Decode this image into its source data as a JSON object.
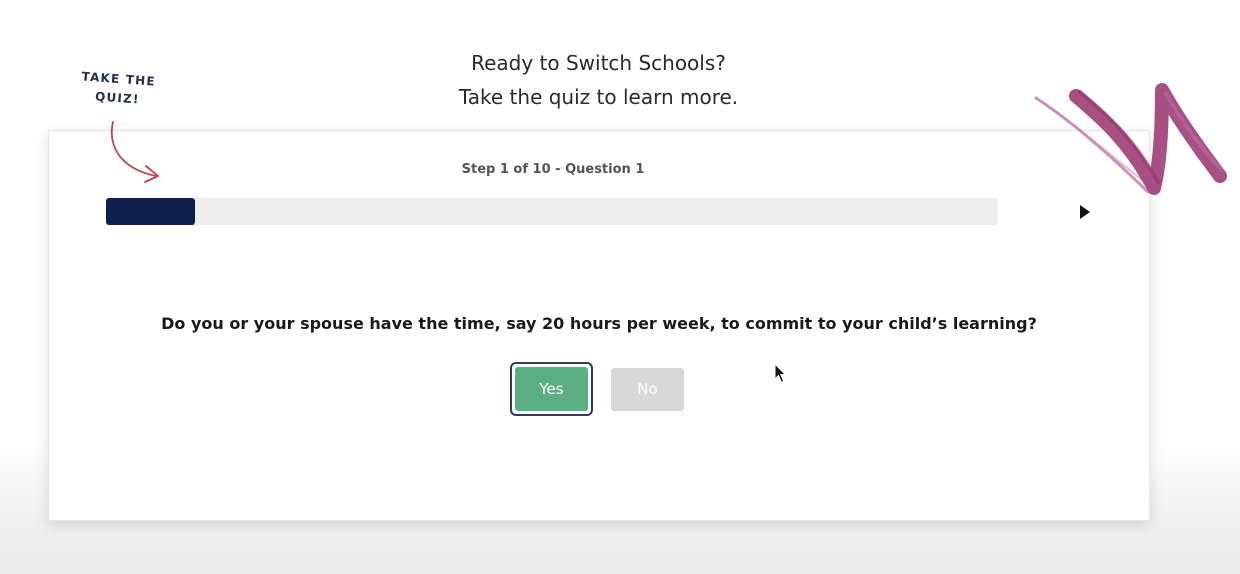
{
  "header": {
    "line1": "Ready to Switch Schools?",
    "line2": "Take the quiz to learn more."
  },
  "badge": {
    "line1": "TAKE THE",
    "line2": "QUIZ!"
  },
  "quiz": {
    "step_label": "Step 1 of 10 - Question 1",
    "progress": 0.1,
    "question": "Do you or your spouse have the time, say 20 hours per week, to commit to your child’s learning?",
    "answers": {
      "yes_label": "Yes",
      "no_label": "No"
    }
  },
  "colors": {
    "progress_fill": "#0d1f4c",
    "progress_track": "#eeeeee",
    "yes_button": "#5bae82",
    "no_button": "#d8d8d8",
    "arrow": "#c0464a",
    "scribble": "#a3467d"
  },
  "icons": {
    "next": "play-triangle-icon",
    "pointer": "mouse-cursor-icon",
    "arrow": "curved-arrow-icon",
    "decoration": "brush-scribble"
  }
}
